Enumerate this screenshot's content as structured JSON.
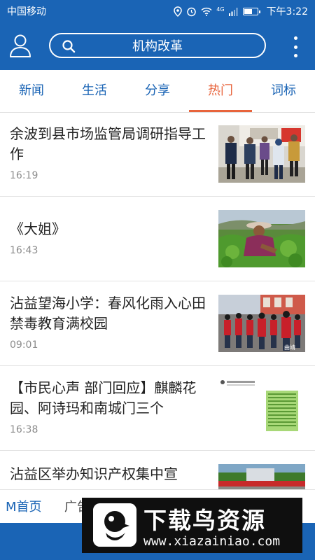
{
  "status_bar": {
    "carrier": "中国移动",
    "network": "4G",
    "time": "下午3:22"
  },
  "header": {
    "search_text": "机构改革"
  },
  "tabs": [
    "新闻",
    "生活",
    "分享",
    "热门",
    "词标"
  ],
  "active_tab": "热门",
  "news": [
    {
      "title": "余波到县市场监管局调研指导工作",
      "time": "16:19",
      "thumb": "officials-visit-photo"
    },
    {
      "title": "《大姐》",
      "time": "16:43",
      "thumb": "tea-picker-photo"
    },
    {
      "title": "沾益望海小学：春风化雨入心田 禁毒教育满校园",
      "time": "09:01",
      "thumb": "school-event-photo",
      "thumb_caption": "曲靖"
    },
    {
      "title": "【市民心声 部门回应】麒麟花园、阿诗玛和南城门三个",
      "time": "16:38",
      "thumb": "document-screenshot"
    },
    {
      "title": "沾益区举办知识产权集中宣",
      "time": "",
      "thumb": "outdoor-event-photo"
    }
  ],
  "bottom_bar": {
    "home": "M首页",
    "ad": "广告"
  },
  "watermark": {
    "title": "下载鸟资源",
    "url": "www.xiazainiao.com"
  },
  "colors": {
    "primary": "#1a64b5",
    "accent": "#e8643c"
  }
}
